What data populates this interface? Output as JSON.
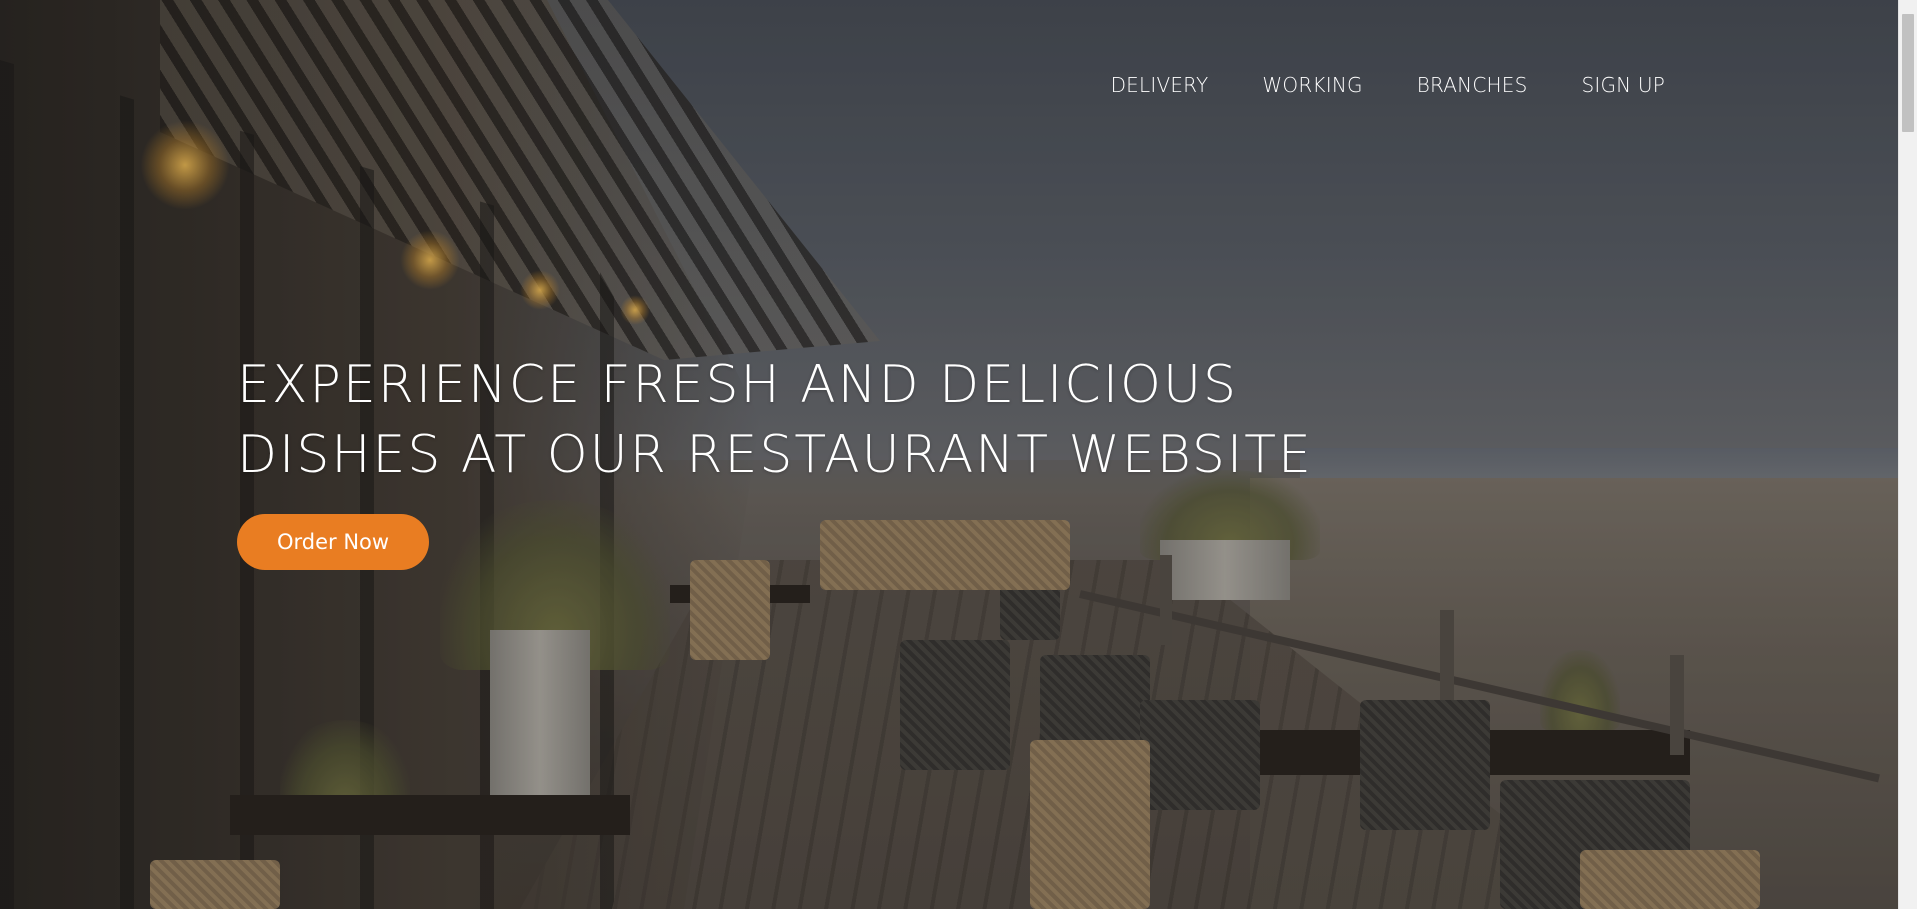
{
  "nav": {
    "items": [
      {
        "label": "DELIVERY"
      },
      {
        "label": "WORKING"
      },
      {
        "label": "BRANCHES"
      },
      {
        "label": "SIGN UP"
      }
    ]
  },
  "hero": {
    "headline_line1": "EXPERIENCE FRESH AND DELICIOUS",
    "headline_line2": "DISHES AT OUR RESTAURANT WEBSITE",
    "cta_label": "Order Now"
  },
  "colors": {
    "accent": "#e97d22",
    "text": "#ffffff"
  }
}
